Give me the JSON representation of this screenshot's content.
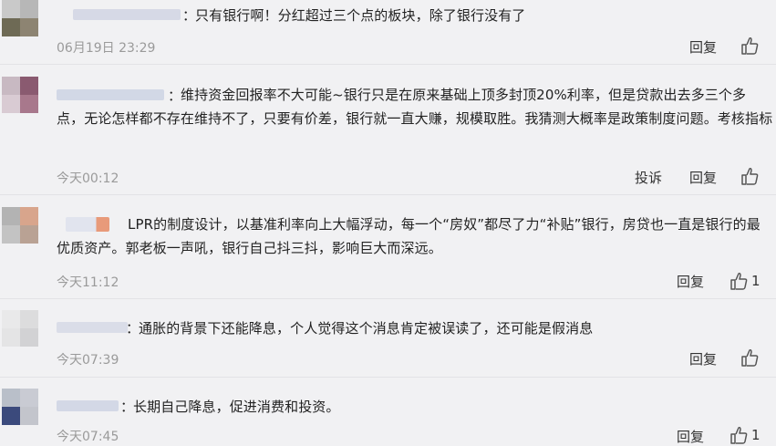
{
  "comments": [
    {
      "colon": "：",
      "text": "只有银行啊！分红超过三个点的板块，除了银行没有了",
      "time": "06月19日 23:29",
      "reply_label": "回复",
      "report_label": "",
      "like_count": "",
      "avatar_colors": [
        "#c9c9c9",
        "#b7b7b7",
        "#6e6a55",
        "#8d8472"
      ],
      "username_color": "#d6d9e6"
    },
    {
      "colon": "：",
      "text": "维持资金回报率不大可能~银行只是在原来基础上顶多封顶20%利率，但是贷款出去多三个多点，无论怎样都不存在维持不了，只要有价差，银行就一直大赚，规模取胜。我猜测大概率是政策制度问题。考核指标",
      "time": "今天00:12",
      "reply_label": "回复",
      "report_label": "投诉",
      "like_count": "",
      "avatar_colors": [
        "#c8b9c2",
        "#8a5a70",
        "#d9cbd3",
        "#a8788c"
      ],
      "username_color": "#d2d8e6"
    },
    {
      "colon": "",
      "text": "LPR的制度设计，以基准利率向上大幅浮动，每一个“房奴”都尽了力“补贴”银行，房贷也一直是银行的最优质资产。郭老板一声吼，银行自己抖三抖，影响巨大而深远。",
      "time": "今天11:12",
      "reply_label": "回复",
      "report_label": "",
      "like_count": "1",
      "avatar_colors": [
        "#b3b3b3",
        "#d8a58c",
        "#c3c3c3",
        "#b9a294"
      ],
      "username_color": "#d6dbe8"
    },
    {
      "colon": "：",
      "text": "通胀的背景下还能降息，个人觉得这个消息肯定被误读了，还可能是假消息",
      "time": "今天07:39",
      "reply_label": "回复",
      "report_label": "",
      "like_count": "",
      "avatar_colors": [
        "#e9e9ea",
        "#dcdcdd",
        "#e4e4e5",
        "#d2d2d4"
      ],
      "username_color": "#dadde8"
    },
    {
      "colon": "：",
      "text": "长期自己降息，促进消费和投资。",
      "time": "今天07:45",
      "reply_label": "回复",
      "report_label": "",
      "like_count": "1",
      "avatar_colors": [
        "#b9bfc9",
        "#c9cbd3",
        "#3b4a7c",
        "#c3c5cc"
      ],
      "username_color": "#d3d8e6"
    }
  ],
  "icons": {
    "like": "thumbs-up-icon"
  }
}
